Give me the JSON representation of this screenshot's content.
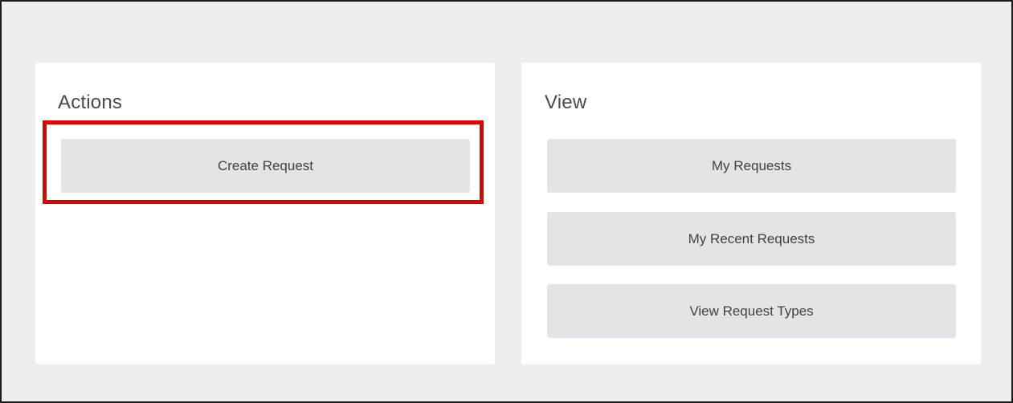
{
  "actions": {
    "title": "Actions",
    "buttons": [
      {
        "label": "Create Request"
      }
    ]
  },
  "view": {
    "title": "View",
    "buttons": [
      {
        "label": "My Requests"
      },
      {
        "label": "My Recent Requests"
      },
      {
        "label": "View Request Types"
      }
    ]
  },
  "annotation": {
    "highlight_color": "#e00000",
    "highlighted": "Create Request"
  },
  "colors": {
    "background": "#eceef0",
    "card": "#ffffff",
    "button": "#e2e5e8"
  }
}
